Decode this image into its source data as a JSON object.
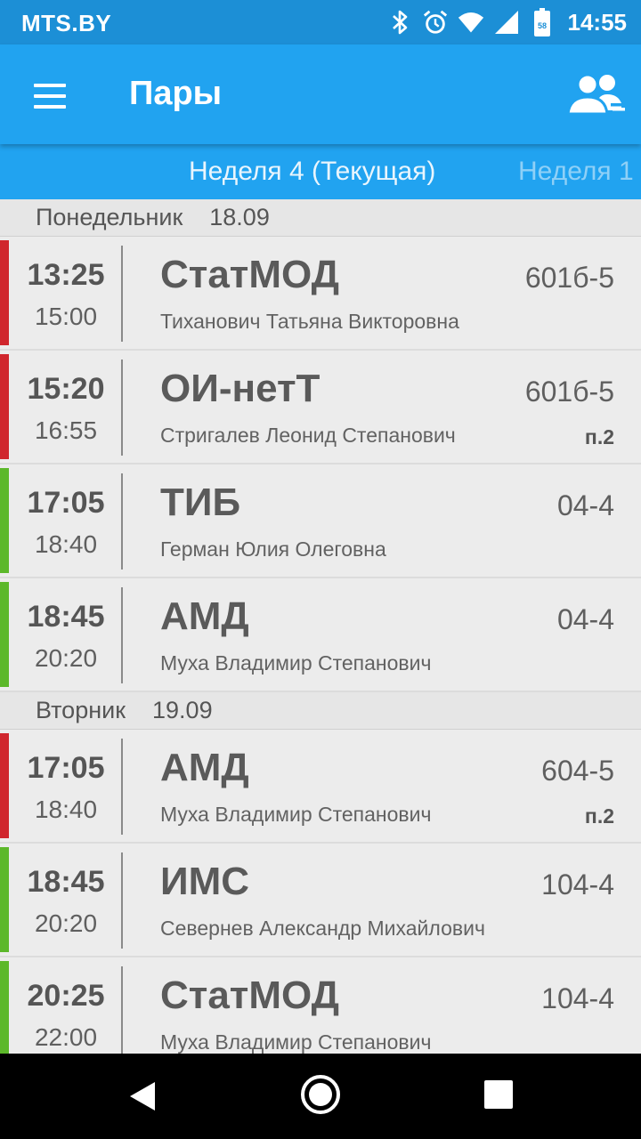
{
  "status_bar": {
    "carrier": "MTS.BY",
    "time": "14:55",
    "battery": "58"
  },
  "app_bar": {
    "title": "Пары"
  },
  "tabs": {
    "current": "Неделя 4 (Текущая)",
    "next": "Неделя 1"
  },
  "days": [
    {
      "name": "Понедельник",
      "date": "18.09",
      "lessons": [
        {
          "start": "13:25",
          "end": "15:00",
          "subject": "СтатМОД",
          "room": "601б-5",
          "teacher": "Тиханович Татьяна Викторовна",
          "subgroup": "",
          "status": "red"
        },
        {
          "start": "15:20",
          "end": "16:55",
          "subject": "ОИ-нетТ",
          "room": "601б-5",
          "teacher": "Стригалев Леонид Степанович",
          "subgroup": "п.2",
          "status": "red"
        },
        {
          "start": "17:05",
          "end": "18:40",
          "subject": "ТИБ",
          "room": "04-4",
          "teacher": "Герман Юлия Олеговна",
          "subgroup": "",
          "status": "green"
        },
        {
          "start": "18:45",
          "end": "20:20",
          "subject": "АМД",
          "room": "04-4",
          "teacher": "Муха Владимир Степанович",
          "subgroup": "",
          "status": "green"
        }
      ]
    },
    {
      "name": "Вторник",
      "date": "19.09",
      "lessons": [
        {
          "start": "17:05",
          "end": "18:40",
          "subject": "АМД",
          "room": "604-5",
          "teacher": "Муха Владимир Степанович",
          "subgroup": "п.2",
          "status": "red"
        },
        {
          "start": "18:45",
          "end": "20:20",
          "subject": "ИМС",
          "room": "104-4",
          "teacher": "Севернев Александр Михайлович",
          "subgroup": "",
          "status": "green"
        },
        {
          "start": "20:25",
          "end": "22:00",
          "subject": "СтатМОД",
          "room": "104-4",
          "teacher": "Муха Владимир Степанович",
          "subgroup": "",
          "status": "green"
        }
      ]
    }
  ],
  "colors": {
    "status_bar": "#1c8fd6",
    "app_bar": "#21a3f0",
    "red": "#d0262d",
    "green": "#5cb82a"
  }
}
